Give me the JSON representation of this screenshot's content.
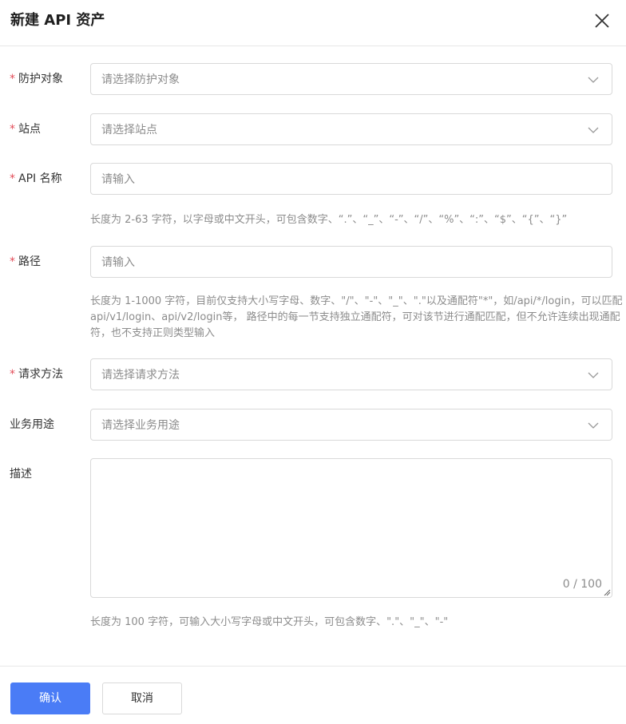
{
  "dialog": {
    "title": "新建 API 资产",
    "close_icon": "close-icon"
  },
  "form": {
    "required_mark": "*",
    "protect_target": {
      "label": "防护对象",
      "placeholder": "请选择防护对象"
    },
    "site": {
      "label": "站点",
      "placeholder": "请选择站点"
    },
    "api_name": {
      "label": "API 名称",
      "placeholder": "请输入",
      "hint": "长度为 2-63 字符，以字母或中文开头，可包含数字、“.”、“_”、“-”、“/”、“%”、“:”、“$”、“{”、“}”"
    },
    "path": {
      "label": "路径",
      "placeholder": "请输入",
      "hint": "长度为 1-1000 字符，目前仅支持大小写字母、数字、\"/\"、\"-\"、\"_\"、\".\"以及通配符\"*\"，如/api/*/login，可以匹配api/v1/login、api/v2/login等， 路径中的每一节支持独立通配符，可对该节进行通配匹配，但不允许连续出现通配符，也不支持正则类型输入"
    },
    "method": {
      "label": "请求方法",
      "placeholder": "请选择请求方法"
    },
    "purpose": {
      "label": "业务用途",
      "placeholder": "请选择业务用途"
    },
    "description": {
      "label": "描述",
      "counter": "0 / 100",
      "hint": "长度为 100 字符，可输入大小写字母或中文开头，可包含数字、\".\"、\"_\"、\"-\""
    }
  },
  "footer": {
    "confirm_label": "确认",
    "cancel_label": "取消"
  },
  "colors": {
    "primary": "#4a7cf6",
    "required": "#e34d59",
    "border": "#d9d9d9",
    "placeholder": "#8c8c8c"
  }
}
